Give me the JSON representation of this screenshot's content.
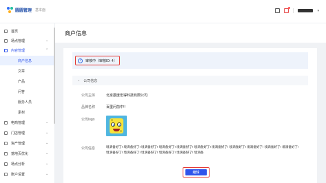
{
  "header": {
    "logo_text": "圆圆管理",
    "logo_sub": "基本面"
  },
  "sidebar": {
    "items": [
      {
        "label": "首页",
        "icon": "home-icon"
      },
      {
        "label": "场点管理",
        "icon": "store-icon"
      },
      {
        "label": "内容管理",
        "icon": "content-icon",
        "open": true
      },
      {
        "label": "电商管理",
        "icon": "cart-icon"
      },
      {
        "label": "门店管理",
        "icon": "shop-icon"
      },
      {
        "label": "资产管理",
        "icon": "asset-icon"
      },
      {
        "label": "落地页优化",
        "icon": "landing-icon"
      },
      {
        "label": "场点分析",
        "icon": "chart-icon"
      },
      {
        "label": "账户设置",
        "icon": "settings-icon"
      }
    ],
    "sub_items": [
      {
        "label": "商户信息",
        "active": true
      },
      {
        "label": "文章"
      },
      {
        "label": "产品"
      },
      {
        "label": "问答"
      },
      {
        "label": "服务人员"
      },
      {
        "label": "素材"
      }
    ]
  },
  "page": {
    "title": "商户信息"
  },
  "status": {
    "text": "审核中（审核ID: 4）"
  },
  "company_section": {
    "title": "公司信息",
    "subject_label": "公司主体",
    "subject_value": "北京震度宏得科技有限公司",
    "short_name_label": "品牌名称",
    "short_name_value": "百里问前中!!",
    "logo_label": "公司logo",
    "intro_label": "公司信息",
    "intro_value": "境滴备好了! 境滴备好了! 境滴备好了! 境滴备好了! 境滴备好了! 境滴备好了! 境滴备好了! 境滴备好了! 境滴备好了! 境滴备好了! 境滴备好了! 境滴备好了! 境滴备好了! 境滴备好了! 境滴备好了! 境滴备好了! 境滴备"
  },
  "actions": {
    "edit_label": "编辑"
  },
  "colors": {
    "accent": "#2f54eb",
    "highlight": "#e53935",
    "status_bg": "#eef3fb"
  }
}
